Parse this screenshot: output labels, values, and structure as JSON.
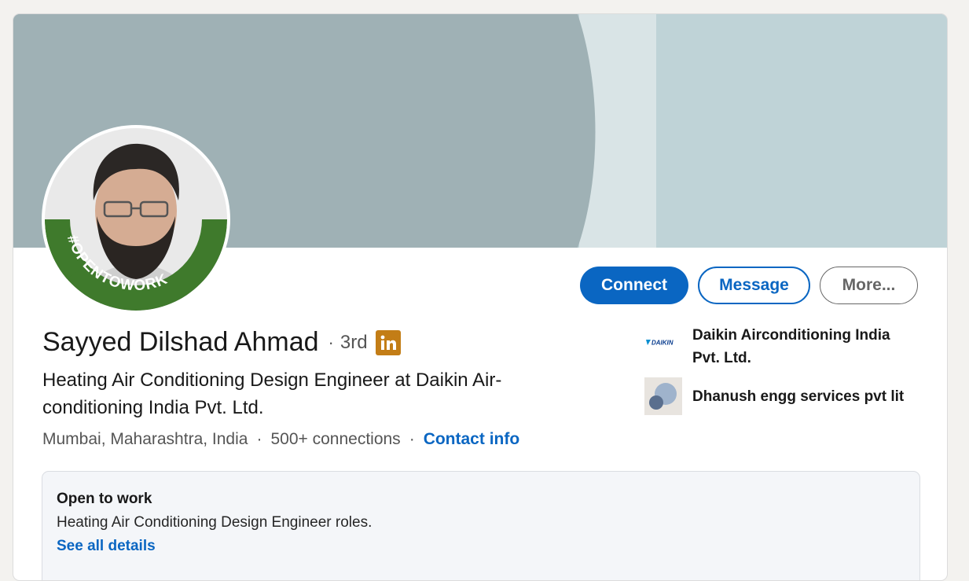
{
  "profile": {
    "name": "Sayyed Dilshad Ahmad",
    "separator": "·",
    "degree": "3rd",
    "headline": "Heating Air Conditioning Design Engineer at Daikin Air-conditioning India Pvt. Ltd.",
    "location": "Mumbai, Maharashtra, India",
    "connections": "500+ connections",
    "contact_info": "Contact info",
    "avatar_frame_text": "#OPENTOWORK"
  },
  "actions": {
    "connect": "Connect",
    "message": "Message",
    "more": "More..."
  },
  "companies": [
    {
      "name": "Daikin Airconditioning India Pvt. Ltd.",
      "logo_text": "DAIKIN",
      "icon": "daikin-logo"
    },
    {
      "name": "Dhanush engg services pvt lit",
      "icon": "circles-logo"
    }
  ],
  "open_to_work": {
    "title": "Open to work",
    "roles": "Heating Air Conditioning Design Engineer roles.",
    "link": "See all details"
  },
  "colors": {
    "accent": "#0a66c2",
    "banner_dark": "#9fb1b5",
    "banner_light": "#bfd3d7",
    "open_to_work_green": "#3f7a2c",
    "linkedin_badge": "#c37d16"
  }
}
